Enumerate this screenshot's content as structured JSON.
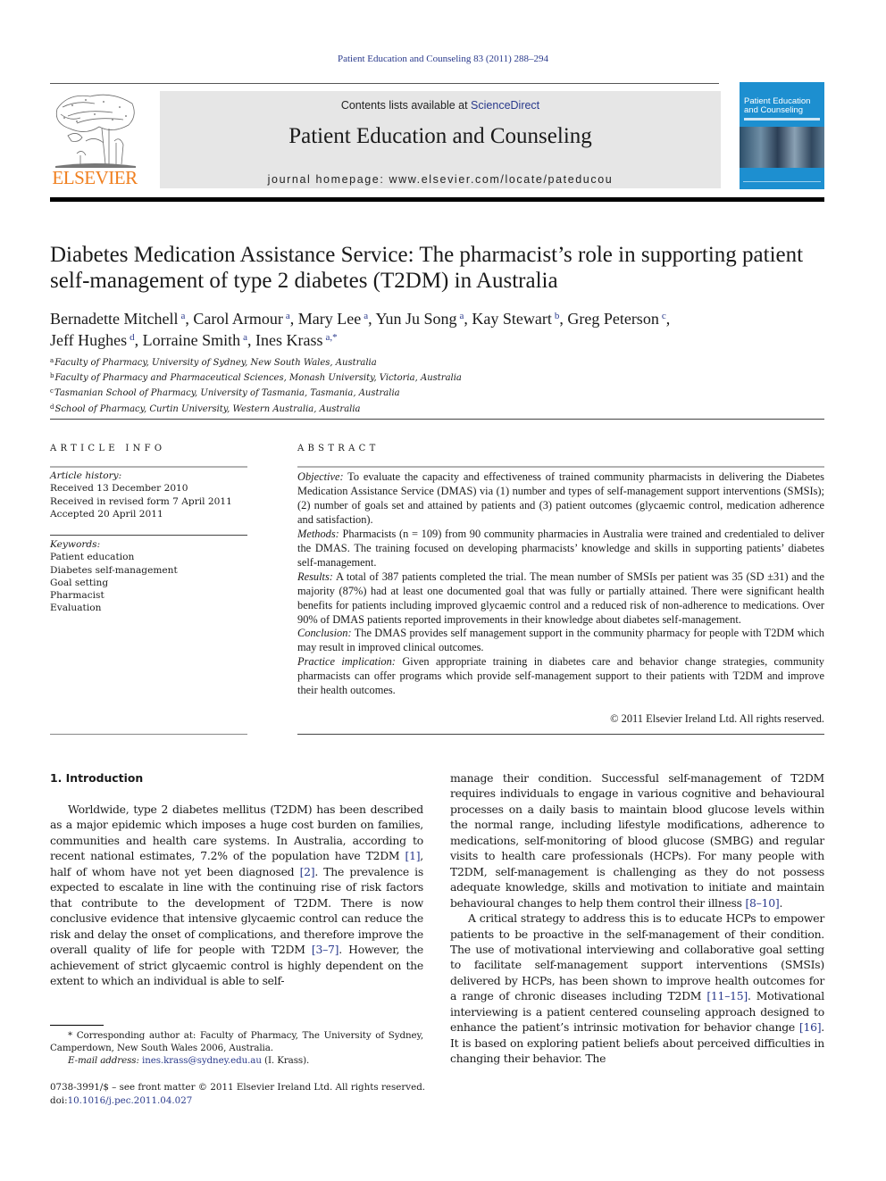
{
  "running_header": "Patient Education and Counseling 83 (2011) 288–294",
  "masthead": {
    "publisher_logo_text": "ELSEVIER",
    "contents_prefix": "Contents lists available at ",
    "contents_link": "ScienceDirect",
    "journal_title": "Patient Education and Counseling",
    "homepage_line": "journal homepage: www.elsevier.com/locate/pateducou",
    "cover_title_line1": "Patient Education",
    "cover_title_line2": "and Counseling"
  },
  "article": {
    "title": "Diabetes Medication Assistance Service: The pharmacist’s role in supporting patient self-management of type 2 diabetes (T2DM) in Australia",
    "authors": [
      {
        "name": "Bernadette Mitchell",
        "aff": "a",
        "sep": ", "
      },
      {
        "name": "Carol Armour",
        "aff": "a",
        "sep": ", "
      },
      {
        "name": "Mary Lee",
        "aff": "a",
        "sep": ", "
      },
      {
        "name": "Yun Ju Song",
        "aff": "a",
        "sep": ", "
      },
      {
        "name": "Kay Stewart",
        "aff": "b",
        "sep": ", "
      },
      {
        "name": "Greg Peterson",
        "aff": "c",
        "sep": ","
      },
      {
        "name": "Jeff Hughes",
        "aff": "d",
        "sep": ", "
      },
      {
        "name": "Lorraine Smith",
        "aff": "a",
        "sep": ", "
      },
      {
        "name": "Ines Krass",
        "aff": "a,*",
        "sep": ""
      }
    ],
    "affiliations": [
      {
        "key": "a",
        "text": "Faculty of Pharmacy, University of Sydney, New South Wales, Australia"
      },
      {
        "key": "b",
        "text": "Faculty of Pharmacy and Pharmaceutical Sciences, Monash University, Victoria, Australia"
      },
      {
        "key": "c",
        "text": "Tasmanian School of Pharmacy, University of Tasmania, Tasmania, Australia"
      },
      {
        "key": "d",
        "text": "School of Pharmacy, Curtin University, Western Australia, Australia"
      }
    ]
  },
  "article_info": {
    "heading": "ARTICLE INFO",
    "history_label": "Article history:",
    "history": [
      "Received 13 December 2010",
      "Received in revised form 7 April 2011",
      "Accepted 20 April 2011"
    ],
    "keywords_label": "Keywords:",
    "keywords": [
      "Patient education",
      "Diabetes self-management",
      "Goal setting",
      "Pharmacist",
      "Evaluation"
    ]
  },
  "abstract": {
    "heading": "ABSTRACT",
    "sections": [
      {
        "label": "Objective:",
        "text": " To evaluate the capacity and effectiveness of trained community pharmacists in delivering the Diabetes Medication Assistance Service (DMAS) via (1) number and types of self-management support interventions (SMSIs); (2) number of goals set and attained by patients and (3) patient outcomes (glycaemic control, medication adherence and satisfaction)."
      },
      {
        "label": "Methods:",
        "text": " Pharmacists (n = 109) from 90 community pharmacies in Australia were trained and credentialed to deliver the DMAS. The training focused on developing pharmacists’ knowledge and skills in supporting patients’ diabetes self-management."
      },
      {
        "label": "Results:",
        "text": " A total of 387 patients completed the trial. The mean number of SMSIs per patient was 35 (SD ±31) and the majority (87%) had at least one documented goal that was fully or partially attained. There were significant health benefits for patients including improved glycaemic control and a reduced risk of non-adherence to medications. Over 90% of DMAS patients reported improvements in their knowledge about diabetes self-management."
      },
      {
        "label": "Conclusion:",
        "text": " The DMAS provides self management support in the community pharmacy for people with T2DM which may result in improved clinical outcomes."
      },
      {
        "label": "Practice implication:",
        "text": " Given appropriate training in diabetes care and behavior change strategies, community pharmacists can offer programs which provide self-management support to their patients with T2DM and improve their health outcomes."
      }
    ],
    "copyright": "© 2011 Elsevier Ireland Ltd. All rights reserved."
  },
  "body": {
    "section_heading": "1.  Introduction",
    "left_column": [
      {
        "t": "Worldwide, type 2 diabetes mellitus (T2DM) has been described as a major epidemic which imposes a huge cost burden on families, communities and health care systems. In Australia, according to recent national estimates, 7.2% of the population have T2DM "
      },
      {
        "r": "[1]"
      },
      {
        "t": ", half of whom have not yet been diagnosed "
      },
      {
        "r": "[2]"
      },
      {
        "t": ". The prevalence is expected to escalate in line with the continuing rise of risk factors that contribute to the development of T2DM. There is now conclusive evidence that intensive glycaemic control can reduce the risk and delay the onset of complications, and therefore improve the overall quality of life for people with T2DM "
      },
      {
        "r": "[3–7]"
      },
      {
        "t": ". However, the achievement of strict glycaemic control is highly dependent on the extent to which an individual is able to self-"
      }
    ],
    "right_column_p1": [
      {
        "t": "manage their condition. Successful self-management of T2DM requires individuals to engage in various cognitive and behavioural processes on a daily basis to maintain blood glucose levels within the normal range, including lifestyle modifications, adherence to medications, self-monitoring of blood glucose (SMBG) and regular visits to health care professionals (HCPs). For many people with T2DM, self-management is challenging as they do not possess adequate knowledge, skills and motivation to initiate and maintain behavioural changes to help them control their illness "
      },
      {
        "r": "[8–10]"
      },
      {
        "t": "."
      }
    ],
    "right_column_p2": [
      {
        "t": "A critical strategy to address this is to educate HCPs to empower patients to be proactive in the self-management of their condition. The use of motivational interviewing and collaborative goal setting to facilitate self-management support interventions (SMSIs) delivered by HCPs, has been shown to improve health outcomes for a range of chronic diseases including T2DM "
      },
      {
        "r": "[11–15]"
      },
      {
        "t": ". Motivational interviewing is a patient centered counseling approach designed to enhance the patient’s intrinsic motivation for behavior change "
      },
      {
        "r": "[16]"
      },
      {
        "t": ". It is based on exploring patient beliefs about perceived difficulties in changing their behavior. The"
      }
    ]
  },
  "footnotes": {
    "corresponding": "* Corresponding author at: Faculty of Pharmacy, The University of Sydney, Camperdown, New South Wales 2006, Australia.",
    "email_label": "E-mail address:",
    "email": "ines.krass@sydney.edu.au",
    "email_suffix": " (I. Krass).",
    "front_matter": "0738-3991/$ – see front matter © 2011 Elsevier Ireland Ltd. All rights reserved.",
    "doi_prefix": "doi:",
    "doi": "10.1016/j.pec.2011.04.027"
  },
  "colors": {
    "link": "#2a3a8c",
    "elsevier_orange": "#f07f1e",
    "masthead_gray": "#e6e6e6",
    "cover_blue": "#1d8fd0"
  }
}
